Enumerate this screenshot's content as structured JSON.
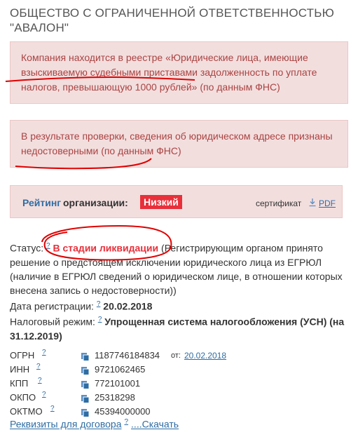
{
  "company": {
    "title": "ОБЩЕСТВО С ОГРАНИЧЕННОЙ ОТВЕТСТВЕННОСТЬЮ \"АВАЛОН\""
  },
  "alerts": [
    {
      "text": "Компания находится в реестре «Юридические лица, имеющие взыскиваемую судебными приставами задолженность по уплате налогов, превышающую 1000 рублей» (по данным ФНС)"
    },
    {
      "text": "В результате проверки, сведения об юридическом адресе признаны недостоверными (по данным ФНС)"
    }
  ],
  "rating": {
    "label_link": "Рейтинг",
    "label_rest": "организации:",
    "value": "Низкий",
    "certificate": "сертификат",
    "pdf": "PDF"
  },
  "status": {
    "label": "Статус:",
    "q": "?",
    "value": "В стадии ликвидации",
    "note": "(Регистрирующим органом принято решение о предстоящем исключении юридического лица из ЕГРЮЛ (наличие в ЕГРЮЛ сведений о юридическом лице, в отношении которых внесена запись о недостоверности))"
  },
  "registration": {
    "label": "Дата регистрации:",
    "q": "?",
    "value": "20.02.2018"
  },
  "tax_regime": {
    "label": "Налоговый режим:",
    "q": "?",
    "value": "Упрощенная система налогообложения (УСН)",
    "date": "(на 31.12.2019)"
  },
  "codes": [
    {
      "label": "ОГРН",
      "q": "?",
      "value": "1187746184834",
      "from_label": "от:",
      "from_date": "20.02.2018"
    },
    {
      "label": "ИНН",
      "q": "?",
      "value": "9721062465"
    },
    {
      "label": "КПП",
      "q": "?",
      "value": "772101001"
    },
    {
      "label": "ОКПО",
      "q": "?",
      "value": "25318298"
    },
    {
      "label": "ОКТМО",
      "q": "?",
      "value": "45394000000"
    }
  ],
  "links": {
    "requisites": "Реквизиты для договора",
    "q": "?",
    "download": "....Скачать"
  },
  "colors": {
    "alert_bg": "#f3dede",
    "alert_text": "#a94442",
    "danger": "#e8303a",
    "link": "#2e6da4",
    "scribble": "#e00000"
  }
}
